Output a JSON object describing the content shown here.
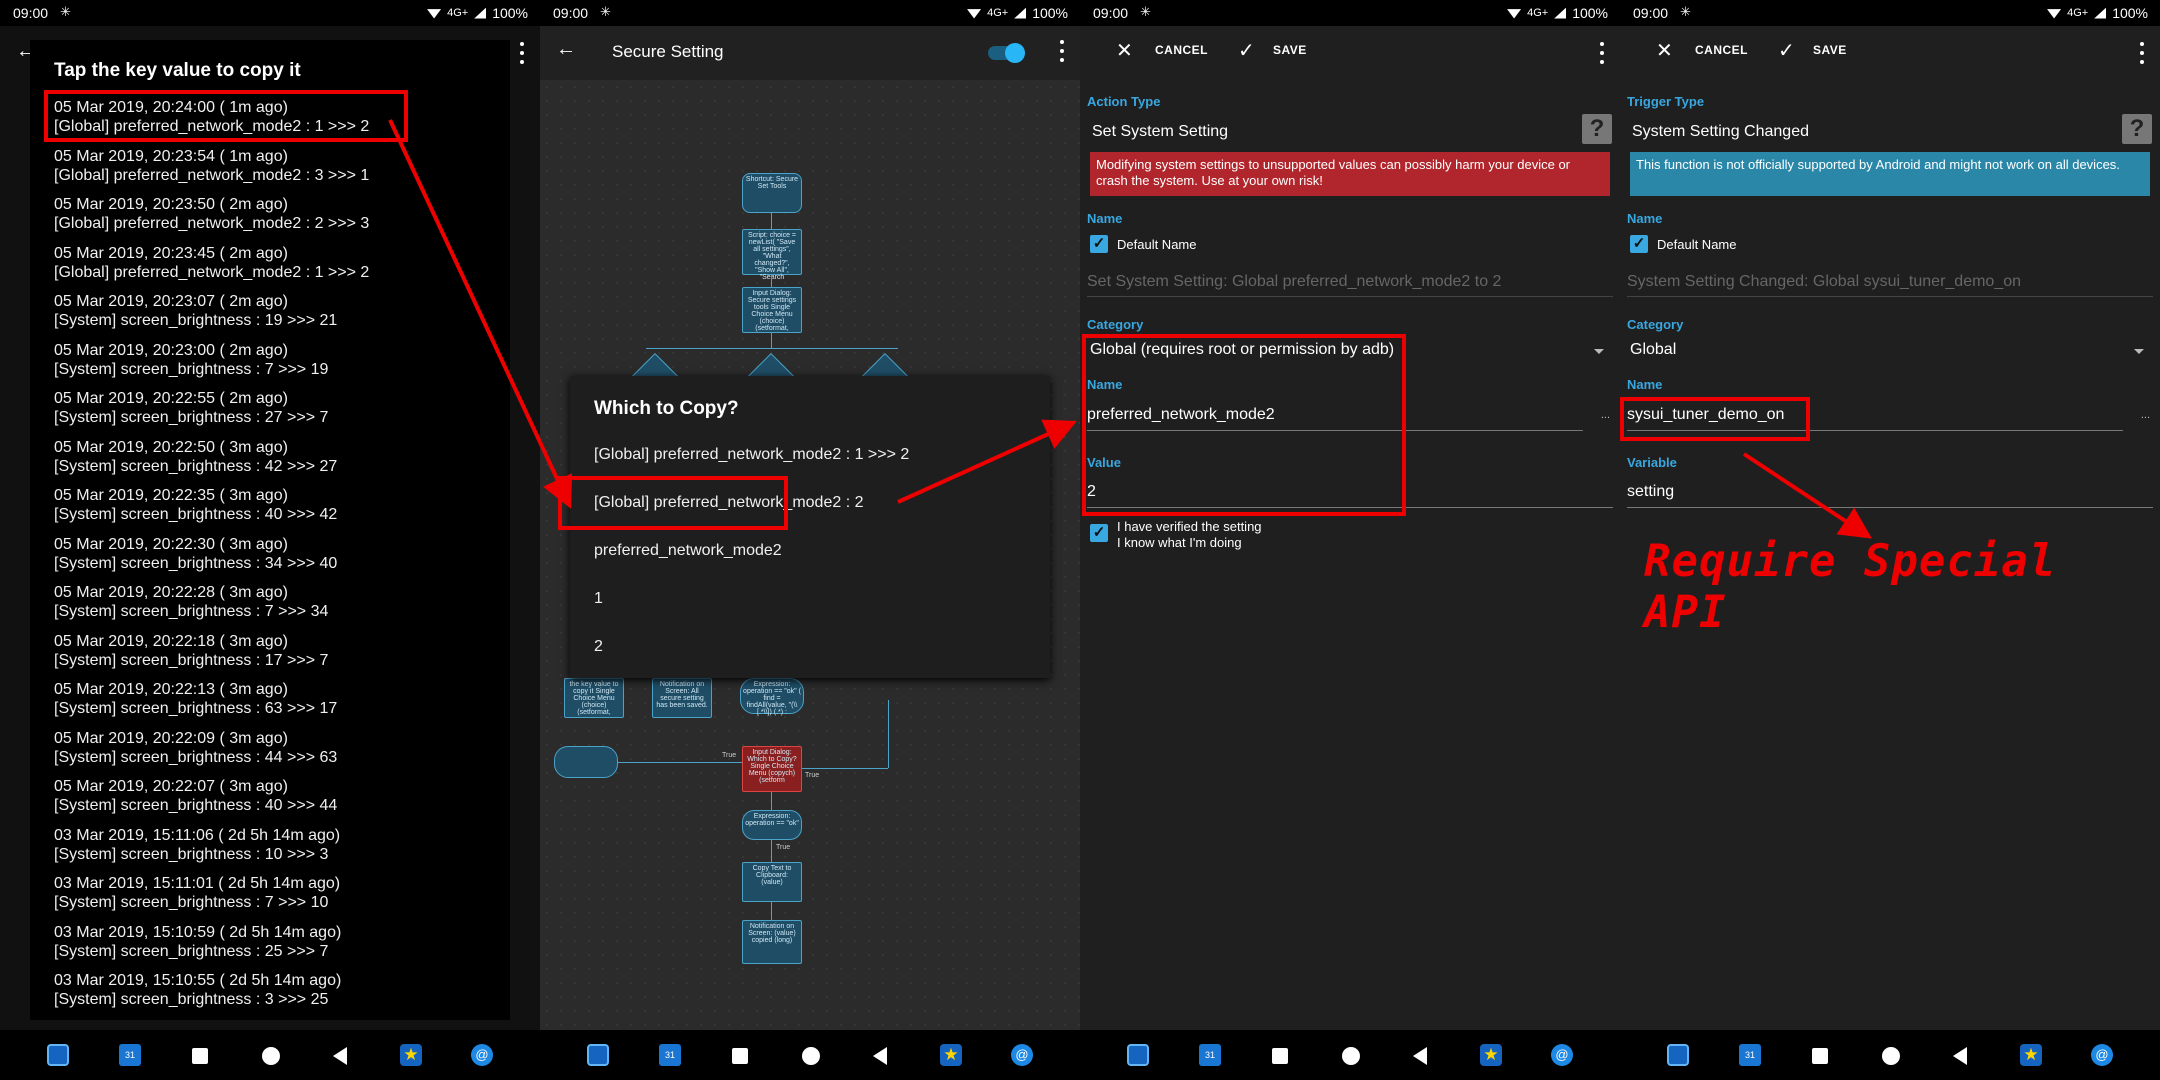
{
  "status": {
    "time": "09:00",
    "network": "4G+",
    "battery": "100%"
  },
  "panel1": {
    "title": "Tap the key value to copy it",
    "entries": [
      {
        "date": "05 Mar 2019,  20:24:00 ( 1m ago)",
        "text": "[Global] preferred_network_mode2 : 1  >>>  2"
      },
      {
        "date": "05 Mar 2019,  20:23:54 ( 1m ago)",
        "text": "[Global] preferred_network_mode2 : 3  >>>  1"
      },
      {
        "date": "05 Mar 2019,  20:23:50 ( 2m ago)",
        "text": "[Global] preferred_network_mode2 : 2  >>>  3"
      },
      {
        "date": "05 Mar 2019,  20:23:45 ( 2m ago)",
        "text": "[Global] preferred_network_mode2 : 1  >>>  2"
      },
      {
        "date": "05 Mar 2019,  20:23:07 ( 2m ago)",
        "text": "[System] screen_brightness : 19  >>>  21"
      },
      {
        "date": "05 Mar 2019,  20:23:00 ( 2m ago)",
        "text": "[System] screen_brightness : 7  >>>  19"
      },
      {
        "date": "05 Mar 2019,  20:22:55 ( 2m ago)",
        "text": "[System] screen_brightness : 27  >>>  7"
      },
      {
        "date": "05 Mar 2019,  20:22:50 ( 3m ago)",
        "text": "[System] screen_brightness : 42  >>>  27"
      },
      {
        "date": "05 Mar 2019,  20:22:35 ( 3m ago)",
        "text": "[System] screen_brightness : 40  >>>  42"
      },
      {
        "date": "05 Mar 2019,  20:22:30 ( 3m ago)",
        "text": "[System] screen_brightness : 34  >>>  40"
      },
      {
        "date": "05 Mar 2019,  20:22:28 ( 3m ago)",
        "text": "[System] screen_brightness : 7  >>>  34"
      },
      {
        "date": "05 Mar 2019,  20:22:18 ( 3m ago)",
        "text": "[System] screen_brightness : 17  >>>  7"
      },
      {
        "date": "05 Mar 2019,  20:22:13 ( 3m ago)",
        "text": "[System] screen_brightness : 63  >>>  17"
      },
      {
        "date": "05 Mar 2019,  20:22:09 ( 3m ago)",
        "text": "[System] screen_brightness : 44  >>>  63"
      },
      {
        "date": "05 Mar 2019,  20:22:07 ( 3m ago)",
        "text": "[System] screen_brightness : 40  >>>  44"
      },
      {
        "date": "03 Mar 2019,  15:11:06 ( 2d 5h 14m ago)",
        "text": "[System] screen_brightness : 10  >>>  3"
      },
      {
        "date": "03 Mar 2019,  15:11:01 ( 2d 5h 14m ago)",
        "text": "[System] screen_brightness : 7  >>>  10"
      },
      {
        "date": "03 Mar 2019,  15:10:59 ( 2d 5h 14m ago)",
        "text": "[System] screen_brightness : 25  >>>  7"
      },
      {
        "date": "03 Mar 2019,  15:10:55 ( 2d 5h 14m ago)",
        "text": "[System] screen_brightness : 3  >>>  25"
      }
    ]
  },
  "panel2": {
    "title": "Secure Setting",
    "dialog_title": "Which to Copy?",
    "options": [
      "[Global] preferred_network_mode2 : 1 >>> 2",
      "[Global] preferred_network_mode2 : 2",
      "preferred_network_mode2",
      "1",
      "2"
    ],
    "nodes": {
      "n1": "Shortcut: Secure Set Tools",
      "n2": "Script: choice = newList( \"Save all settings\", \"What changed?\", \"Show All\", \"Search",
      "n3": "Input Dialog: Secure settings tools Single Choice Menu (choice)(setformat,",
      "n4": "the key value to copy it Single Choice Menu (choice)(setformat,",
      "n5": "Notification on Screen: All secure setting has been saved.",
      "n6": "Expression: operation == \"ok\" ( find = findAll(value, \"(\\\\[.*\\\\]) (.*) :",
      "n7": "Input Dialog: Which to Copy? Single Choice Menu (copych)(setform",
      "n8": "Expression: operation == \"ok\"",
      "n9": "Copy Text to Clipboard: (value)",
      "n10": "Notification on Screen: (value)",
      "n10b": "copied (long)",
      "t1": "True",
      "t2": "True",
      "t3": "True",
      "t4": "True"
    }
  },
  "panel3": {
    "cancel": "CANCEL",
    "save": "SAVE",
    "type_label": "Action Type",
    "type_value": "Set System Setting",
    "help": "?",
    "warning": "Modifying system settings to unsupported values can possibly harm your device or crash the system. Use at your own risk!",
    "name_label": "Name",
    "default_name": "Default Name",
    "name_placeholder": "Set System Setting: Global preferred_network_mode2 to 2",
    "category_label": "Category",
    "category_value": "Global (requires root or permission by adb)",
    "setting_name_label": "Name",
    "setting_name": "preferred_network_mode2",
    "value_label": "Value",
    "value": "2",
    "ellipsis": "...",
    "verify_line1": "I have verified the setting",
    "verify_line2": "I know what I'm doing"
  },
  "panel4": {
    "cancel": "CANCEL",
    "save": "SAVE",
    "type_label": "Trigger Type",
    "type_value": "System Setting Changed",
    "help": "?",
    "info": "This function is not officially supported by Android and might not work on all devices.",
    "name_label": "Name",
    "default_name": "Default Name",
    "name_placeholder": "System Setting Changed: Global sysui_tuner_demo_on",
    "category_label": "Category",
    "category_value": "Global",
    "setting_name_label": "Name",
    "setting_name": "sysui_tuner_demo_on",
    "variable_label": "Variable",
    "variable": "setting",
    "ellipsis": "...",
    "annotation": "Require Special API"
  },
  "colors": {
    "accent": "#39a7e0",
    "highlight": "#e00000",
    "warning": "#b0262c",
    "info": "#2a87a8"
  }
}
